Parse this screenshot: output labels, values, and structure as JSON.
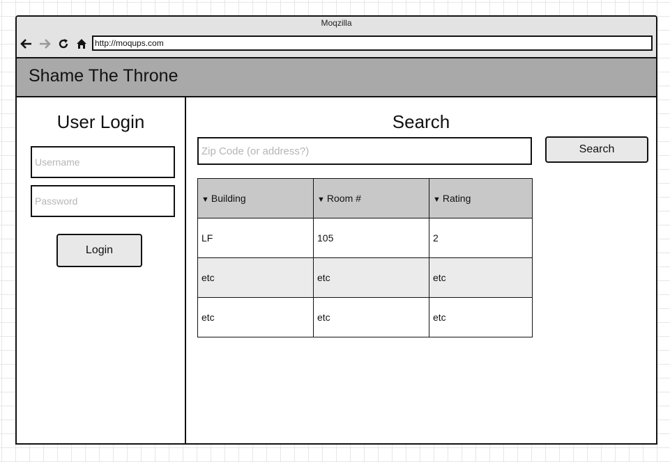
{
  "window": {
    "title": "Moqzilla",
    "url": "http://moqups.com"
  },
  "header": {
    "title": "Shame The Throne"
  },
  "login": {
    "title": "User Login",
    "username_placeholder": "Username",
    "password_placeholder": "Password",
    "login_label": "Login"
  },
  "search": {
    "title": "Search",
    "placeholder": "Zip Code (or address?)",
    "button_label": "Search"
  },
  "table": {
    "columns": [
      "Building",
      "Room #",
      "Rating"
    ],
    "rows": [
      [
        "LF",
        "105",
        "2"
      ],
      [
        "etc",
        "etc",
        "etc"
      ],
      [
        "etc",
        "etc",
        "etc"
      ]
    ]
  },
  "icons": {
    "back": "arrow-left-icon",
    "forward": "arrow-right-icon",
    "reload": "reload-icon",
    "home": "home-icon",
    "sort": "sort-down-icon"
  },
  "colors": {
    "header_bg": "#a9a9a9",
    "chrome_bg": "#e3e3e3",
    "table_header_bg": "#c8c8c8",
    "alt_row_bg": "#ebebeb",
    "button_bg": "#e8e8e8"
  }
}
